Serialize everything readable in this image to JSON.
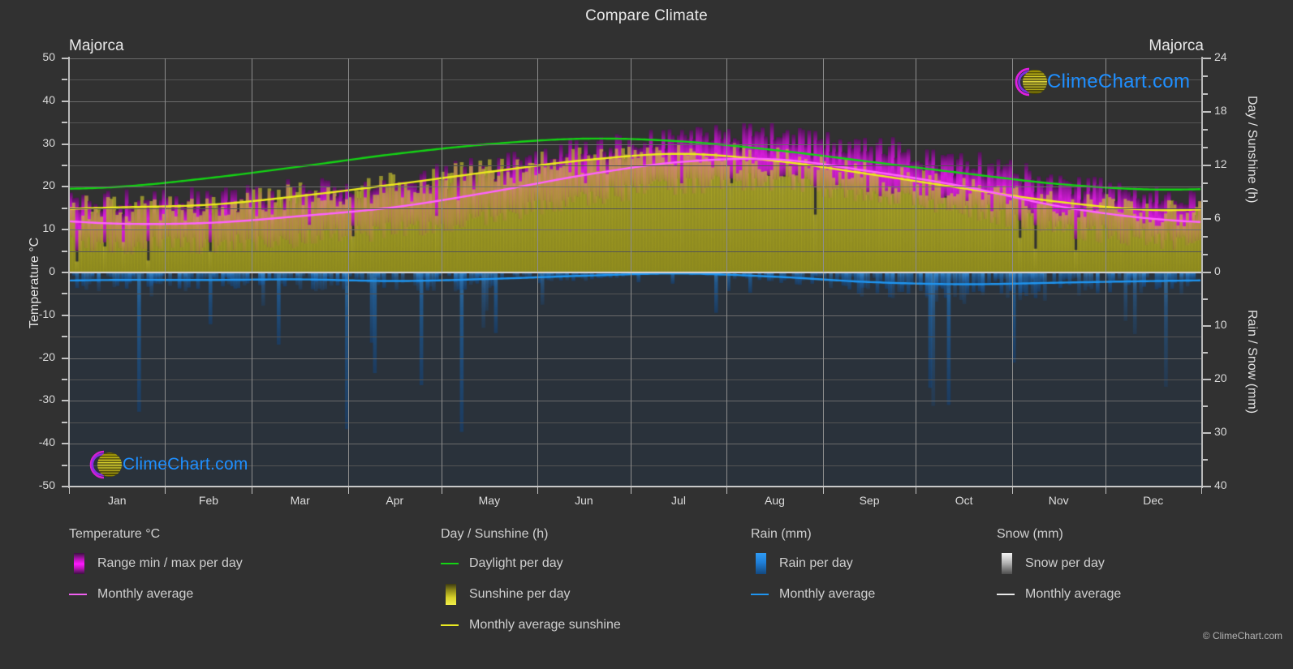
{
  "header": {
    "title": "Compare Climate",
    "location_left": "Majorca",
    "location_right": "Majorca"
  },
  "brand": {
    "name": "ClimeChart.com",
    "copyright": "© ClimeChart.com",
    "text_color": "#1f8fff",
    "ring_color": "#d41fd4",
    "sphere_color": "#d9cf17"
  },
  "axes": {
    "left_title": "Temperature °C",
    "right_title_top": "Day / Sunshine (h)",
    "right_title_bottom": "Rain / Snow (mm)",
    "y_left_ticks": [
      "50",
      "40",
      "30",
      "20",
      "10",
      "0",
      "-10",
      "-20",
      "-30",
      "-40",
      "-50"
    ],
    "y_right_top_ticks": [
      "24",
      "18",
      "12",
      "6",
      "0"
    ],
    "y_right_bottom_ticks": [
      "0",
      "10",
      "20",
      "30",
      "40"
    ],
    "x_ticks": [
      "Jan",
      "Feb",
      "Mar",
      "Apr",
      "May",
      "Jun",
      "Jul",
      "Aug",
      "Sep",
      "Oct",
      "Nov",
      "Dec"
    ]
  },
  "legend": {
    "groups": [
      {
        "title": "Temperature °C",
        "entries": [
          {
            "label": "Range min / max per day",
            "mark": "swatch-magenta-gradient",
            "color": "#ef12ef"
          },
          {
            "label": "Monthly average",
            "mark": "line",
            "color": "#f060f0"
          }
        ]
      },
      {
        "title": "Day / Sunshine (h)",
        "entries": [
          {
            "label": "Daylight per day",
            "mark": "line",
            "color": "#14d414"
          },
          {
            "label": "Sunshine per day",
            "mark": "swatch-yellow-gradient",
            "color": "#e8e82a"
          },
          {
            "label": "Monthly average sunshine",
            "mark": "line",
            "color": "#eaea22"
          }
        ]
      },
      {
        "title": "Rain (mm)",
        "entries": [
          {
            "label": "Rain per day",
            "mark": "swatch-blue-gradient",
            "color": "#1f8fe8"
          },
          {
            "label": "Monthly average",
            "mark": "line",
            "color": "#1f95f0"
          }
        ]
      },
      {
        "title": "Snow (mm)",
        "entries": [
          {
            "label": "Snow per day",
            "mark": "swatch-white-gradient",
            "color": "#e6e6e6"
          },
          {
            "label": "Monthly average",
            "mark": "line",
            "color": "#e8e8e8"
          }
        ]
      }
    ]
  },
  "chart_data": {
    "type": "area",
    "title": "Compare Climate",
    "subtitle": "Majorca",
    "xlabel": "",
    "ylabel": "Temperature °C",
    "categories": [
      "Jan",
      "Feb",
      "Mar",
      "Apr",
      "May",
      "Jun",
      "Jul",
      "Aug",
      "Sep",
      "Oct",
      "Nov",
      "Dec"
    ],
    "axis": {
      "left": {
        "label": "Temperature °C",
        "min": -50,
        "max": 50,
        "step": 10,
        "minor_step": 5
      },
      "right_top": {
        "label": "Day / Sunshine (h)",
        "min": 0,
        "max": 24,
        "step": 6
      },
      "right_bottom": {
        "label": "Rain / Snow (mm)",
        "min": 0,
        "max": 40,
        "step": 10
      }
    },
    "grid": true,
    "legend_position": "below",
    "series": [
      {
        "name": "Monthly average temperature",
        "unit": "°C",
        "axis": "left",
        "color": "#f060f0",
        "values": [
          11.4,
          11.6,
          13.2,
          15.3,
          18.8,
          22.8,
          25.8,
          26.4,
          23.6,
          20.0,
          15.4,
          12.5
        ]
      },
      {
        "name": "Temperature range min per day",
        "unit": "°C",
        "axis": "left",
        "color": "#c020c0",
        "values": [
          6.5,
          6.6,
          7.9,
          9.8,
          13.2,
          17.2,
          20.2,
          20.9,
          18.2,
          14.8,
          10.4,
          7.8
        ]
      },
      {
        "name": "Temperature range max per day",
        "unit": "°C",
        "axis": "left",
        "color": "#ef12ef",
        "values": [
          16.0,
          16.3,
          18.2,
          20.5,
          24.2,
          28.2,
          31.2,
          31.6,
          28.6,
          25.0,
          20.2,
          17.1
        ]
      },
      {
        "name": "Daylight per day",
        "unit": "h",
        "axis": "right_top",
        "color": "#14d414",
        "values": [
          9.6,
          10.6,
          11.9,
          13.3,
          14.4,
          15.0,
          14.7,
          13.7,
          12.4,
          11.1,
          9.9,
          9.3
        ]
      },
      {
        "name": "Monthly average sunshine",
        "unit": "h",
        "axis": "right_top",
        "color": "#eaea22",
        "values": [
          7.3,
          7.6,
          8.6,
          9.9,
          11.3,
          12.6,
          13.3,
          12.5,
          11.0,
          9.4,
          7.9,
          7.0
        ]
      },
      {
        "name": "Monthly average rain",
        "unit": "mm",
        "axis": "right_bottom",
        "color": "#1f95f0",
        "values": [
          1.4,
          1.4,
          1.3,
          1.6,
          1.2,
          0.6,
          0.2,
          0.8,
          1.8,
          2.2,
          1.9,
          1.6
        ]
      },
      {
        "name": "Monthly average snow",
        "unit": "mm",
        "axis": "right_bottom",
        "color": "#e8e8e8",
        "values": [
          0,
          0,
          0,
          0,
          0,
          0,
          0,
          0,
          0,
          0,
          0,
          0
        ]
      }
    ]
  }
}
